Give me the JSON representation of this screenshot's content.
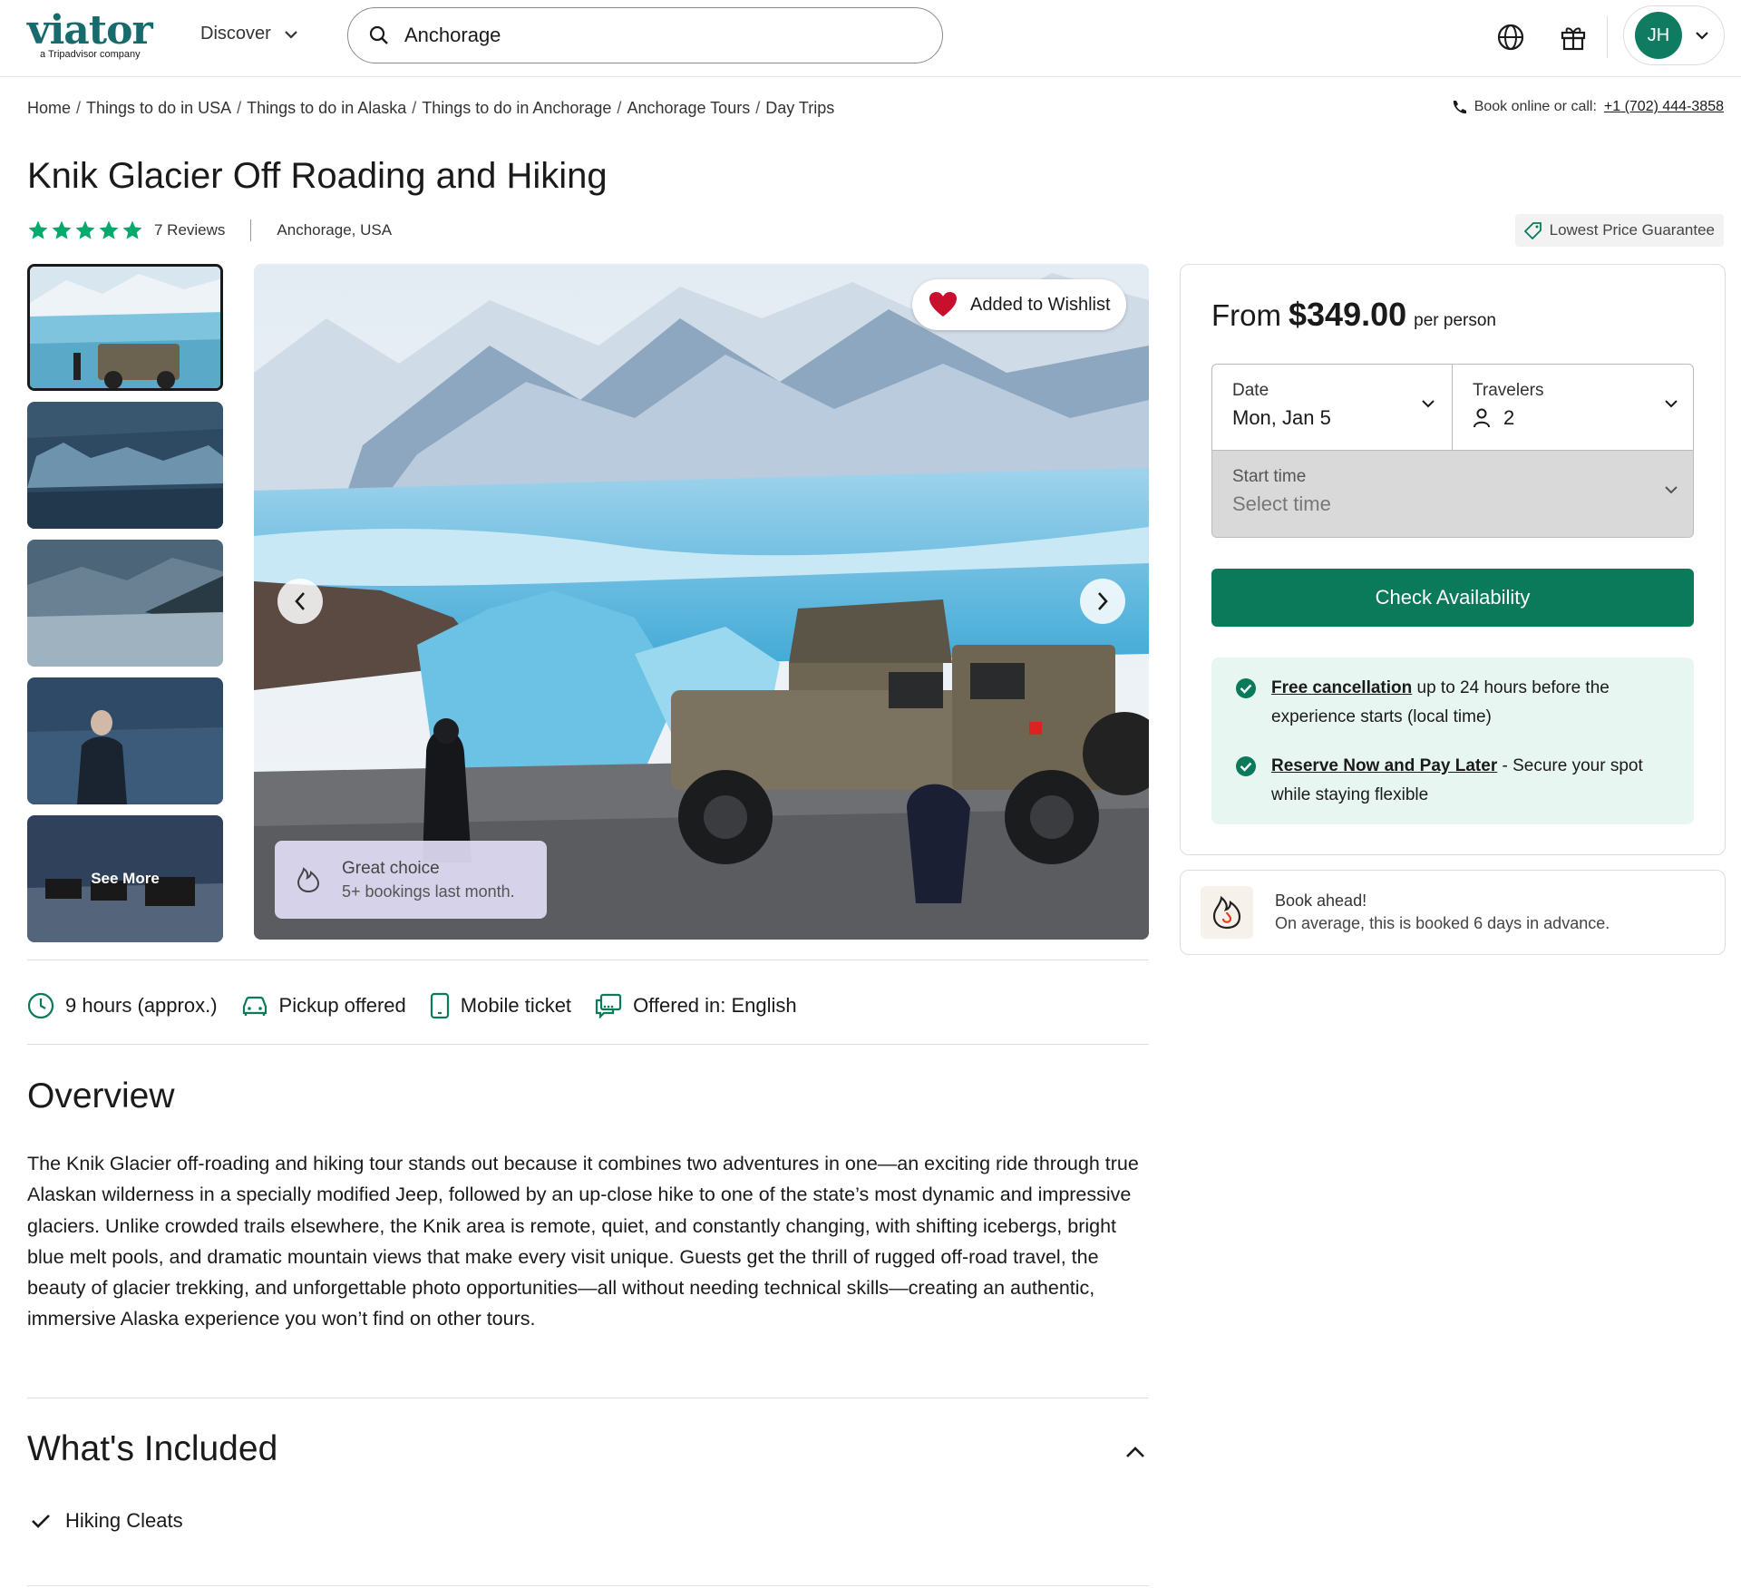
{
  "header": {
    "logo_text": "viator",
    "logo_sub": "a Tripadvisor company",
    "discover_label": "Discover",
    "search_value": "Anchorage",
    "user_initials": "JH"
  },
  "breadcrumb": [
    "Home",
    "Things to do in USA",
    "Things to do in Alaska",
    "Things to do in Anchorage",
    "Anchorage Tours",
    "Day Trips"
  ],
  "contact": {
    "label": "Book online or call:",
    "phone": "+1 (702) 444-3858"
  },
  "product": {
    "title": "Knik Glacier Off Roading and Hiking",
    "rating": 5,
    "reviews_label": "7 Reviews",
    "location": "Anchorage, USA",
    "lowest_price_label": "Lowest Price Guarantee"
  },
  "gallery": {
    "see_more": "See More",
    "wishlist_label": "Added to Wishlist",
    "badge_title": "Great choice",
    "badge_sub": "5+ bookings last month."
  },
  "booking": {
    "from_label": "From",
    "price": "$349.00",
    "per_person": "per person",
    "date_label": "Date",
    "date_value": "Mon, Jan 5",
    "travelers_label": "Travelers",
    "travelers_value": "2",
    "start_time_label": "Start time",
    "start_time_placeholder": "Select time",
    "check_button": "Check Availability",
    "perks": [
      {
        "link": "Free cancellation",
        "text": " up to 24 hours before the experience starts (local time)"
      },
      {
        "link": "Reserve Now and Pay Later",
        "text": " - Secure your spot while staying flexible"
      }
    ],
    "book_ahead_title": "Book ahead!",
    "book_ahead_text": "On average, this is booked 6 days in advance."
  },
  "features": [
    {
      "icon": "clock-icon",
      "label": "9 hours (approx.)"
    },
    {
      "icon": "car-icon",
      "label": "Pickup offered"
    },
    {
      "icon": "mobile-icon",
      "label": "Mobile ticket"
    },
    {
      "icon": "chat-icon",
      "label": "Offered in: English"
    }
  ],
  "overview": {
    "heading": "Overview",
    "text": "The Knik Glacier off-roading and hiking tour stands out because it combines two adventures in one—an exciting ride through true Alaskan wilderness in a specially modified Jeep, followed by an up-close hike to one of the state’s most dynamic and impressive glaciers. Unlike crowded trails elsewhere, the Knik area is remote, quiet, and constantly changing, with shifting icebergs, bright blue melt pools, and dramatic mountain views that make every visit unique. Guests get the thrill of rugged off-road travel, the beauty of glacier trekking, and unforgettable photo opportunities—all without needing technical skills—creating an authentic, immersive Alaska experience you won’t find on other tours."
  },
  "included": {
    "heading": "What's Included",
    "items": [
      "Hiking Cleats"
    ]
  },
  "colors": {
    "brand": "#186b6d",
    "cta": "#0b7a5a",
    "star": "#00aa6c",
    "heart": "#c8102e"
  }
}
